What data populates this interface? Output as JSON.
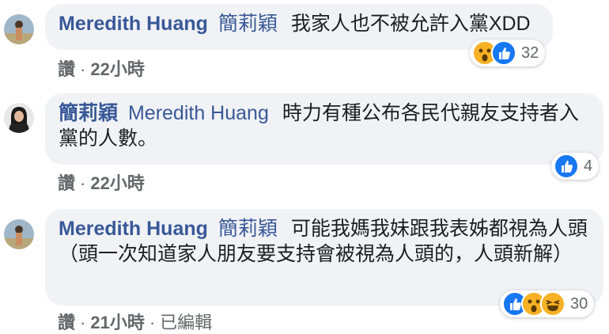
{
  "comments": [
    {
      "author": "Meredith Huang",
      "mention": "簡莉穎",
      "text": "我家人也不被允許入黨XDD",
      "like_label": "讚",
      "time": "22小時",
      "edited": "",
      "reaction_count": "32",
      "reactions": [
        "wow-icon",
        "like-icon"
      ]
    },
    {
      "author": "簡莉穎",
      "mention": "",
      "text_mention": "Meredith Huang",
      "text": "時力有種公布各民代親友支持者入黨的人數。",
      "like_label": "讚",
      "time": "22小時",
      "edited": "",
      "reaction_count": "4",
      "reactions": [
        "like-icon"
      ]
    },
    {
      "author": "Meredith Huang",
      "mention": "簡莉穎",
      "text": "可能我媽我妹跟我表姊都視為人頭（頭一次知道家人朋友要支持會被視為人頭的，人頭新解）",
      "like_label": "讚",
      "time": "21小時",
      "edited": "已編輯",
      "reaction_count": "30",
      "reactions": [
        "like-icon",
        "wow-icon",
        "haha-icon"
      ]
    }
  ],
  "colors": {
    "link": "#385898",
    "bubble": "#f0f2f5",
    "meta": "#65676b",
    "like": "#1877f2",
    "emoji": "#f7b125"
  }
}
